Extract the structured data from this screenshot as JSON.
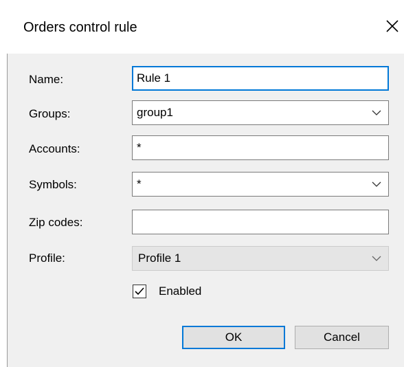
{
  "window": {
    "title": "Orders control rule"
  },
  "form": {
    "name": {
      "label": "Name:",
      "value": "Rule 1"
    },
    "groups": {
      "label": "Groups:",
      "value": "group1"
    },
    "accounts": {
      "label": "Accounts:",
      "value": "*"
    },
    "symbols": {
      "label": "Symbols:",
      "value": "*"
    },
    "zip_codes": {
      "label": "Zip codes:",
      "value": ""
    },
    "profile": {
      "label": "Profile:",
      "value": "Profile 1"
    },
    "enabled": {
      "label": "Enabled",
      "checked": true
    }
  },
  "buttons": {
    "ok": "OK",
    "cancel": "Cancel"
  },
  "colors": {
    "focus_accent": "#0078d7",
    "dialog_background": "#f0f0f0"
  },
  "icons": {
    "close": "close-icon",
    "dropdown": "chevron-down-icon",
    "check": "checkmark-icon"
  }
}
